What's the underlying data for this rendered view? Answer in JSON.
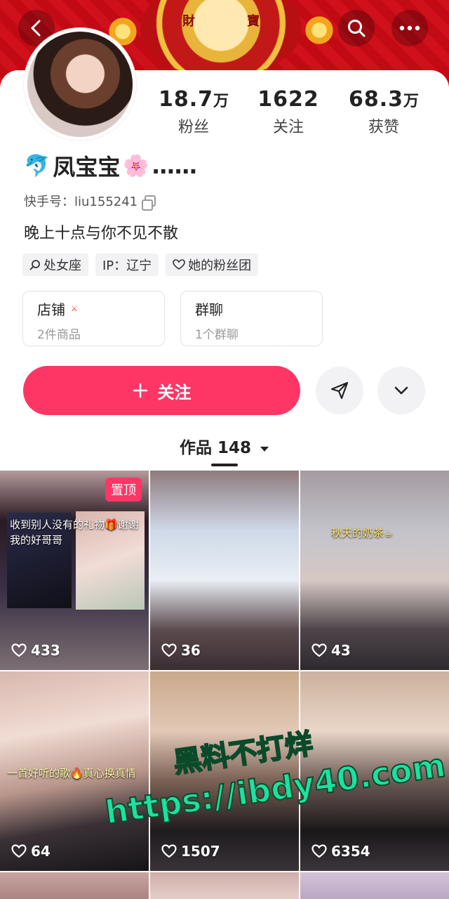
{
  "header": {
    "banner_chars": [
      "財",
      "寶"
    ],
    "accent": "#fe3666"
  },
  "profile": {
    "name": "凤宝宝",
    "name_suffix": "……",
    "id_label": "快手号：liu155241",
    "bio": "晚上十点与你不见不散",
    "tags": [
      "处女座",
      "IP：辽宁",
      "她的粉丝团"
    ]
  },
  "stats": [
    {
      "num": "18.7",
      "unit": "万",
      "label": "粉丝"
    },
    {
      "num": "1622",
      "unit": "",
      "label": "关注"
    },
    {
      "num": "68.3",
      "unit": "万",
      "label": "获赞"
    }
  ],
  "cards": [
    {
      "title": "店铺",
      "sub": "2件商品"
    },
    {
      "title": "群聊",
      "sub": "1个群聊"
    }
  ],
  "actions": {
    "follow_label": "关注"
  },
  "works": {
    "tab_label": "作品 148"
  },
  "videos": [
    {
      "likes": "433",
      "pinned": "置顶",
      "caption1": "收到别人没有的礼物🎁谢谢",
      "caption2": "我的好哥哥"
    },
    {
      "likes": "36"
    },
    {
      "likes": "43",
      "caption1": "秋天的奶茶☕"
    },
    {
      "likes": "64",
      "caption1": "一首好听的歌🔥真心换真情"
    },
    {
      "likes": "1507"
    },
    {
      "likes": "6354"
    }
  ],
  "watermark": {
    "line1": "黑料不打烊",
    "line2": "https://ibdy40.com"
  }
}
